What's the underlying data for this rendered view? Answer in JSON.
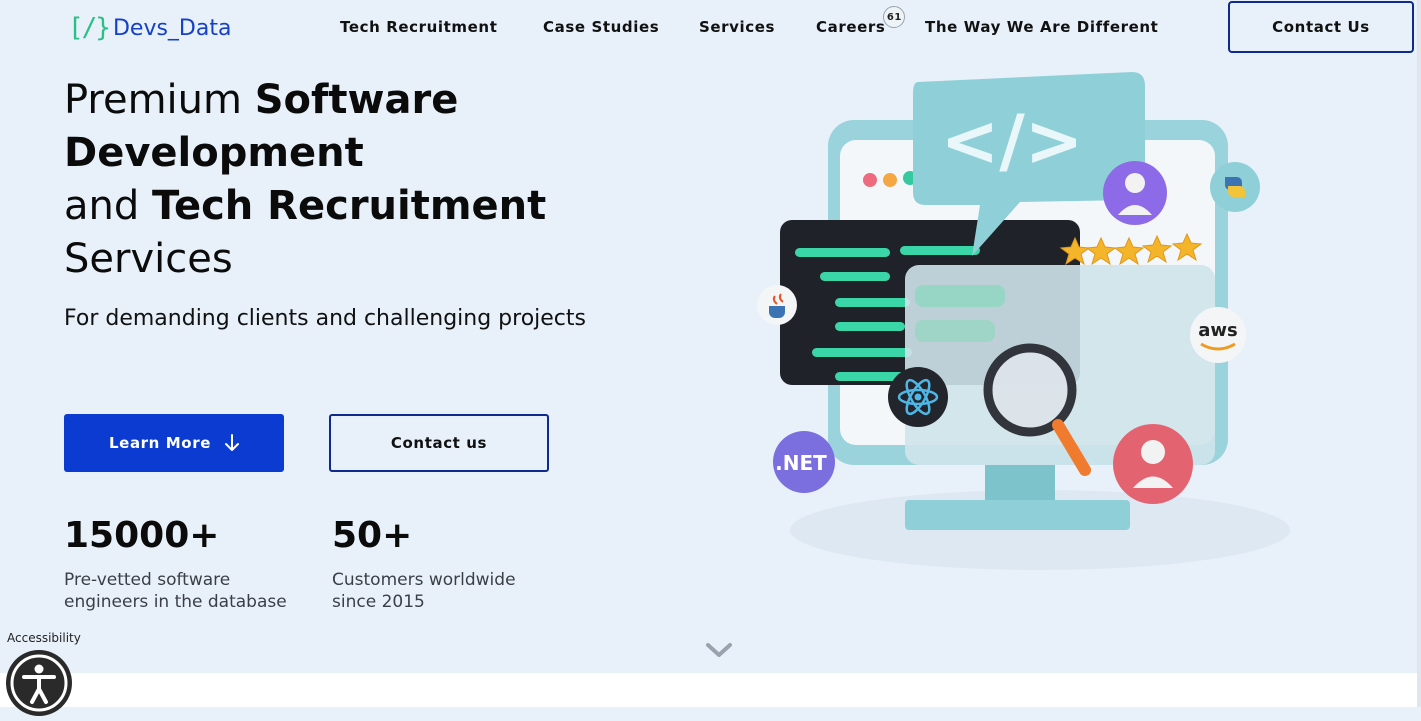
{
  "header": {
    "logo_mark": "[/}",
    "logo_text": "Devs_Data",
    "nav": [
      {
        "label": "Tech Recruitment"
      },
      {
        "label": "Case Studies"
      },
      {
        "label": "Services"
      },
      {
        "label": "Careers",
        "badge": "61"
      },
      {
        "label": "The Way We Are Different"
      }
    ],
    "contact_button": "Contact Us"
  },
  "hero": {
    "headline": {
      "part1": "Premium ",
      "part2_bold": "Software Development",
      "part3": "and ",
      "part4_bold": "Tech Recruitment",
      "part5": "Services"
    },
    "subline": "For demanding clients and challenging projects",
    "learn_more_button": "Learn More",
    "contact_button": "Contact us",
    "stats": [
      {
        "value": "15000+",
        "label": "Pre-vetted software engineers in the database"
      },
      {
        "value": "50+",
        "label": "Customers worldwide since 2015"
      }
    ]
  },
  "illustration": {
    "code_symbol": "</>",
    "badges": [
      ".NET",
      "aws",
      "java",
      "python",
      "react"
    ]
  },
  "accessibility": {
    "label": "Accessibility"
  },
  "colors": {
    "brand_blue": "#0b3bd1",
    "brand_green": "#2bbf87",
    "hero_bg": "#e8f1fa",
    "border_navy": "#0d2a8c"
  },
  "icons": [
    "arrow-down-icon",
    "chevron-down-icon",
    "accessibility-icon",
    "magnifier-icon",
    "star-icon"
  ]
}
